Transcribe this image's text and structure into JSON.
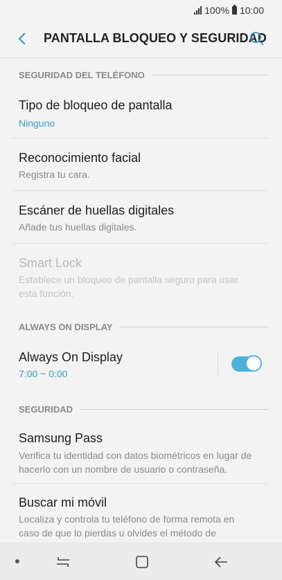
{
  "status_bar": {
    "battery": "100%",
    "time": "10:00"
  },
  "header": {
    "title": "PANTALLA BLOQUEO Y SEGURIDAD",
    "back_icon": "chevron-left-icon",
    "search_icon": "search-icon"
  },
  "sections": {
    "phone_security": "SEGURIDAD DEL TELÉFONO",
    "always_on": "ALWAYS ON DISPLAY",
    "security": "SEGURIDAD"
  },
  "items": {
    "lock_type": {
      "title": "Tipo de bloqueo de pantalla",
      "subtitle": "Ninguno"
    },
    "face": {
      "title": "Reconocimiento facial",
      "subtitle": "Registra tu cara."
    },
    "fingerprint": {
      "title": "Escáner de huellas digitales",
      "subtitle": "Añade tus huellas digitales."
    },
    "smart_lock": {
      "title": "Smart Lock",
      "subtitle": "Establece un bloqueo de pantalla seguro para usar esta función."
    },
    "aod": {
      "title": "Always On Display",
      "subtitle": "7:00 ~ 0:00",
      "enabled": true
    },
    "samsung_pass": {
      "title": "Samsung Pass",
      "subtitle": "Verifica tu identidad con datos biométricos en lugar de hacerlo con un nombre de usuario o contraseña."
    },
    "find_mobile": {
      "title": "Buscar mi móvil",
      "subtitle": "Localiza y controla tu teléfono de forma remota en caso de que lo pierdas u olvides el método de desbloqueo."
    }
  },
  "colors": {
    "accent": "#3b9bc4",
    "toggle_on": "#4fb3d9",
    "background": "#f3f3f3"
  }
}
